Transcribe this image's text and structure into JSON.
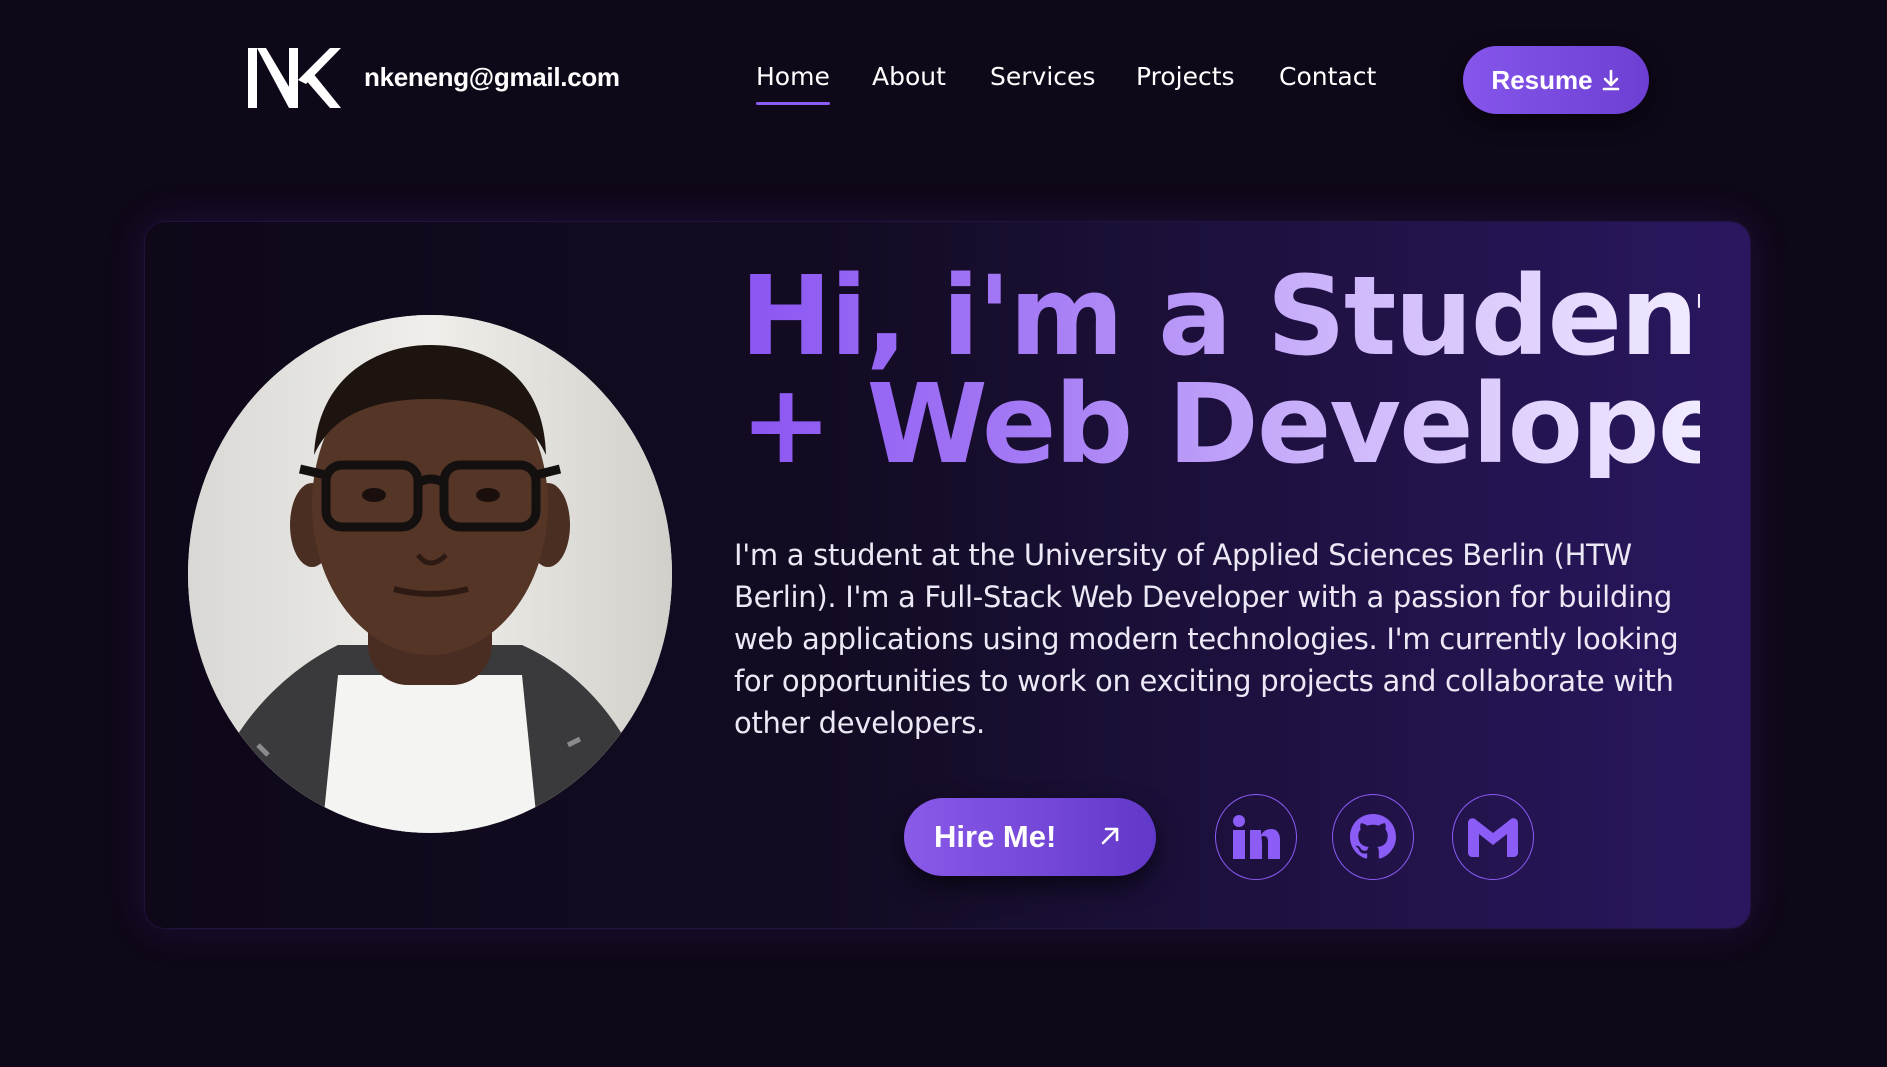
{
  "header": {
    "logo_text": "NK",
    "email": "nkeneng@gmail.com",
    "nav": [
      {
        "label": "Home",
        "active": true
      },
      {
        "label": "About",
        "active": false
      },
      {
        "label": "Services",
        "active": false
      },
      {
        "label": "Projects",
        "active": false
      },
      {
        "label": "Contact",
        "active": false
      }
    ],
    "resume_label": "Resume",
    "resume_icon": "download-icon"
  },
  "hero": {
    "headline_line1": "Hi, i'm a Student",
    "headline_line2": "+ Web Developer",
    "bio": "I'm a student at the University of Applied Sciences Berlin (HTW Berlin). I'm a Full-Stack Web Developer with a passion for building web applications using modern technologies. I'm currently looking for opportunities to work on exciting projects and collaborate with other developers.",
    "hire_label": "Hire Me!",
    "hire_icon": "arrow-up-right-icon",
    "socials": [
      {
        "icon": "linkedin-icon"
      },
      {
        "icon": "github-icon"
      },
      {
        "icon": "gmail-icon"
      }
    ]
  },
  "theme": {
    "background": "#0f0818",
    "accent": "#8b5cf6",
    "accent_light": "#d9c8fb"
  }
}
